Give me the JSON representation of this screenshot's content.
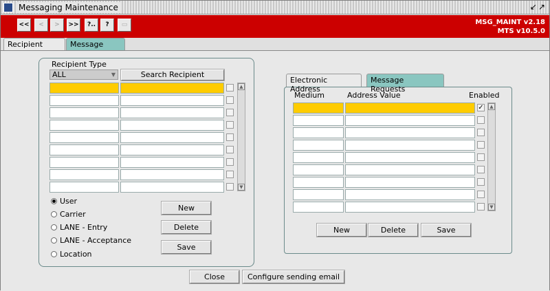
{
  "window": {
    "title": "Messaging Maintenance"
  },
  "toolbar": {
    "buttons": [
      "<<",
      "<",
      ">",
      ">>",
      "?..",
      "?",
      ""
    ],
    "version_line1": "MSG_MAINT v2.18",
    "version_line2": "MTS v10.5.0"
  },
  "tabs": [
    {
      "label": "Recipient Config",
      "active": true
    },
    {
      "label": "Message Config",
      "active": false
    }
  ],
  "recipient": {
    "type_label": "Recipient Type",
    "type_value": "ALL",
    "search_button": "Search Recipient",
    "radios": [
      {
        "label": "User",
        "selected": true
      },
      {
        "label": "Carrier",
        "selected": false
      },
      {
        "label": "LANE - Entry",
        "selected": false
      },
      {
        "label": "LANE - Acceptance",
        "selected": false
      },
      {
        "label": "Location",
        "selected": false
      }
    ],
    "new_button": "New",
    "delete_button": "Delete",
    "save_button": "Save"
  },
  "message": {
    "tabs": [
      {
        "label": "Electronic Address",
        "active": true
      },
      {
        "label": "Message Requests",
        "active": false
      }
    ],
    "col_medium": "Medium",
    "col_address": "Address Value",
    "col_enabled": "Enabled",
    "new_button": "New",
    "delete_button": "Delete",
    "save_button": "Save"
  },
  "footer": {
    "close_button": "Close",
    "configure_button": "Configure sending email"
  }
}
